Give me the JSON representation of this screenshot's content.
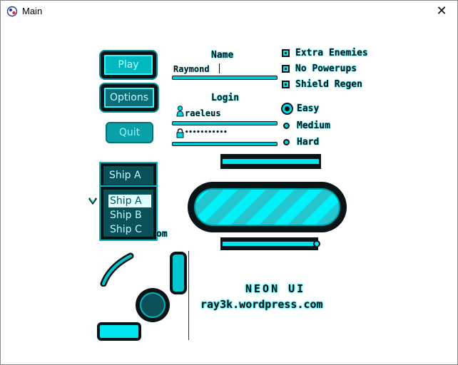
{
  "window": {
    "title": "Main"
  },
  "menu": {
    "play": "Play",
    "options": "Options",
    "quit": "Quit"
  },
  "name_field": {
    "label": "Name",
    "value": "Raymond"
  },
  "login": {
    "label": "Login",
    "username": "raeleus",
    "password_masked": "•••••••••••"
  },
  "checkboxes": [
    {
      "label": "Extra Enemies"
    },
    {
      "label": "No Powerups"
    },
    {
      "label": "Shield Regen"
    }
  ],
  "difficulty": {
    "options": [
      "Easy",
      "Medium",
      "Hard"
    ],
    "selected": "Easy"
  },
  "ship_select": {
    "selected": "Ship A",
    "options": [
      "Ship A",
      "Ship B",
      "Ship C"
    ]
  },
  "overflow_text": "om",
  "progress": {
    "fraction": 1.0
  },
  "slider": {
    "fraction": 0.94
  },
  "brand": {
    "line1": "NEON UI",
    "line2": "ray3k.wordpress.com"
  },
  "colors": {
    "accent": "#00e6f0",
    "dark": "#0a1417",
    "mid": "#0a5058"
  }
}
